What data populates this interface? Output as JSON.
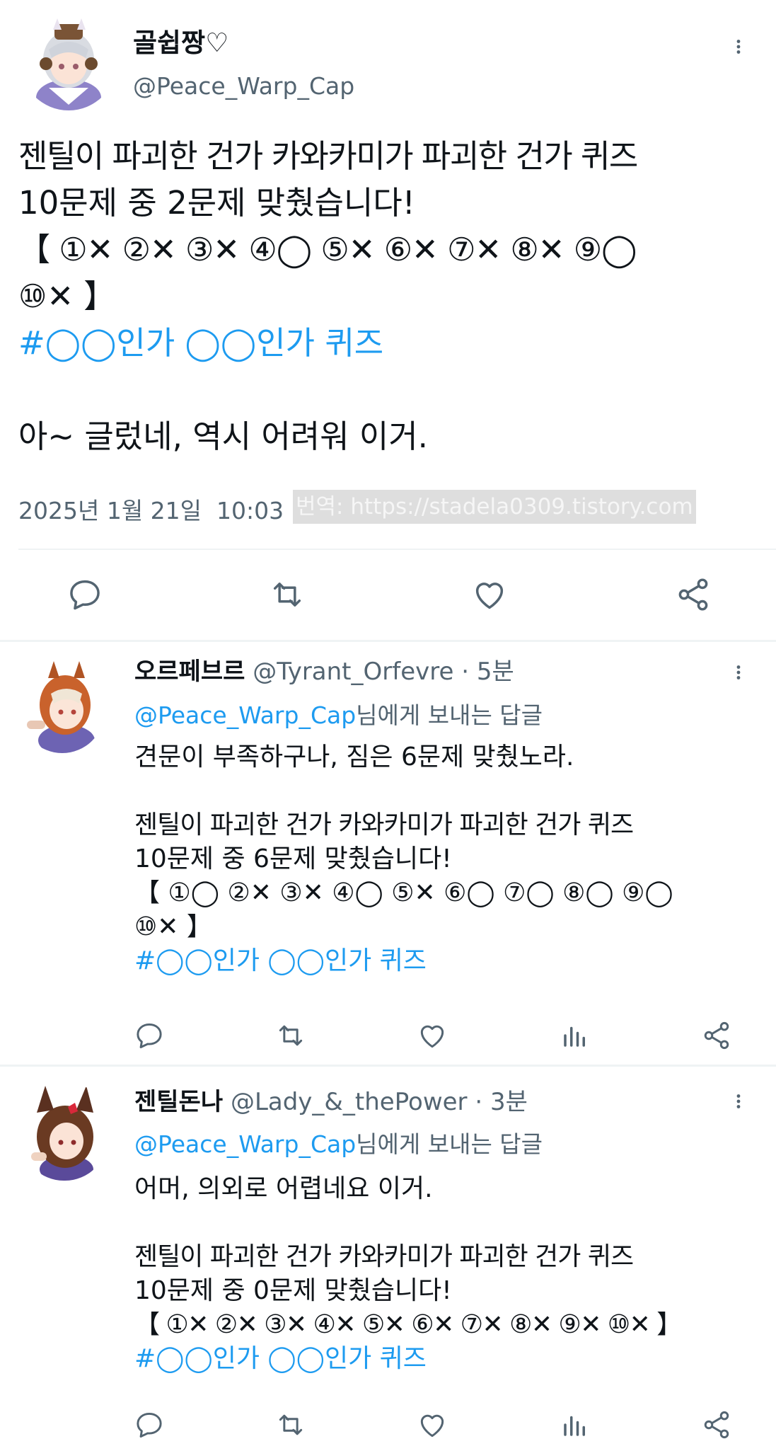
{
  "main_tweet": {
    "display_name": "골쉽짱♡",
    "handle": "@Peace_Warp_Cap",
    "line1": "젠틸이 파괴한 건가 카와카미가 파괴한 건가 퀴즈",
    "line2": "10문제 중 2문제 맞췄습니다!",
    "line3": "【 ①✕ ②✕ ③✕ ④◯ ⑤✕ ⑥✕ ⑦✕ ⑧✕ ⑨◯",
    "line4": "⑩✕ 】",
    "hashtag": "#◯◯인가 ◯◯인가 퀴즈",
    "comment": "아~ 글렀네, 역시 어려워 이거.",
    "timestamp": "2025년 1월 21일  10:03",
    "watermark": "번역: https://stadela0309.tistory.com"
  },
  "replies": [
    {
      "display_name": "오르페브르",
      "handle": "@Tyrant_Orfevre",
      "time": "· 5분",
      "reply_to_handle": "@Peace_Warp_Cap",
      "reply_to_suffix": "님에게 보내는 답글",
      "comment": "견문이 부족하구나, 짐은 6문제 맞췄노라.",
      "line1": "젠틸이 파괴한 건가 카와카미가 파괴한 건가 퀴즈",
      "line2": "10문제 중 6문제 맞췄습니다!",
      "line3": "【 ①◯ ②✕ ③✕ ④◯ ⑤✕ ⑥◯ ⑦◯ ⑧◯ ⑨◯",
      "line4": "⑩✕ 】",
      "hashtag": "#◯◯인가 ◯◯인가 퀴즈"
    },
    {
      "display_name": "젠틸돈나",
      "handle": "@Lady_&_thePower",
      "time": "· 3분",
      "reply_to_handle": "@Peace_Warp_Cap",
      "reply_to_suffix": "님에게 보내는 답글",
      "comment": "어머, 의외로 어렵네요 이거.",
      "line1": "젠틸이 파괴한 건가 카와카미가 파괴한 건가 퀴즈",
      "line2": "10문제 중 0문제 맞췄습니다!",
      "line3": "【 ①✕ ②✕ ③✕ ④✕ ⑤✕ ⑥✕ ⑦✕ ⑧✕ ⑨✕ ⑩✕ 】",
      "hashtag": "#◯◯인가 ◯◯인가 퀴즈"
    }
  ],
  "icons": {
    "more": "more-vertical-icon",
    "reply": "reply-icon",
    "retweet": "retweet-icon",
    "like": "like-icon",
    "analytics": "analytics-icon",
    "share": "share-icon"
  },
  "colors": {
    "link": "#1d9bf0",
    "muted": "#536471",
    "text": "#0f1419",
    "divider": "#eff3f4"
  }
}
